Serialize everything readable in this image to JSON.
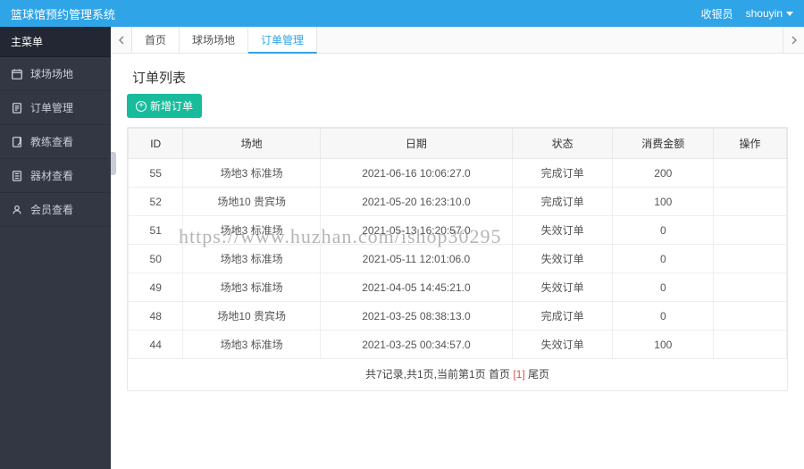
{
  "topbar": {
    "brand": "篮球馆预约管理系统",
    "role": "收银员",
    "user": "shouyin"
  },
  "sidebar": {
    "title": "主菜单",
    "items": [
      {
        "label": "球场场地"
      },
      {
        "label": "订单管理"
      },
      {
        "label": "教练查看"
      },
      {
        "label": "器材查看"
      },
      {
        "label": "会员查看"
      }
    ]
  },
  "tabs": {
    "items": [
      {
        "label": "首页"
      },
      {
        "label": "球场场地"
      },
      {
        "label": "订单管理"
      }
    ],
    "active_index": 2
  },
  "panel": {
    "title": "订单列表",
    "add_label": "新增订单"
  },
  "table": {
    "headers": [
      "ID",
      "场地",
      "日期",
      "状态",
      "消费金额",
      "操作"
    ],
    "rows": [
      {
        "id": "55",
        "venue": "场地3 标准场",
        "date": "2021-06-16 10:06:27.0",
        "status": "完成订单",
        "amount": "200",
        "op": ""
      },
      {
        "id": "52",
        "venue": "场地10 贵宾场",
        "date": "2021-05-20 16:23:10.0",
        "status": "完成订单",
        "amount": "100",
        "op": ""
      },
      {
        "id": "51",
        "venue": "场地3 标准场",
        "date": "2021-05-13 16:20:57.0",
        "status": "失效订单",
        "amount": "0",
        "op": ""
      },
      {
        "id": "50",
        "venue": "场地3 标准场",
        "date": "2021-05-11 12:01:06.0",
        "status": "失效订单",
        "amount": "0",
        "op": ""
      },
      {
        "id": "49",
        "venue": "场地3 标准场",
        "date": "2021-04-05 14:45:21.0",
        "status": "失效订单",
        "amount": "0",
        "op": ""
      },
      {
        "id": "48",
        "venue": "场地10 贵宾场",
        "date": "2021-03-25 08:38:13.0",
        "status": "完成订单",
        "amount": "0",
        "op": ""
      },
      {
        "id": "44",
        "venue": "场地3 标准场",
        "date": "2021-03-25 00:34:57.0",
        "status": "失效订单",
        "amount": "100",
        "op": ""
      }
    ]
  },
  "pager": {
    "prefix": "共7记录,共1页,当前第1页 首页 ",
    "current": "[1]",
    "suffix": " 尾页"
  },
  "watermark": "https://www.huzhan.com/ishop30295"
}
